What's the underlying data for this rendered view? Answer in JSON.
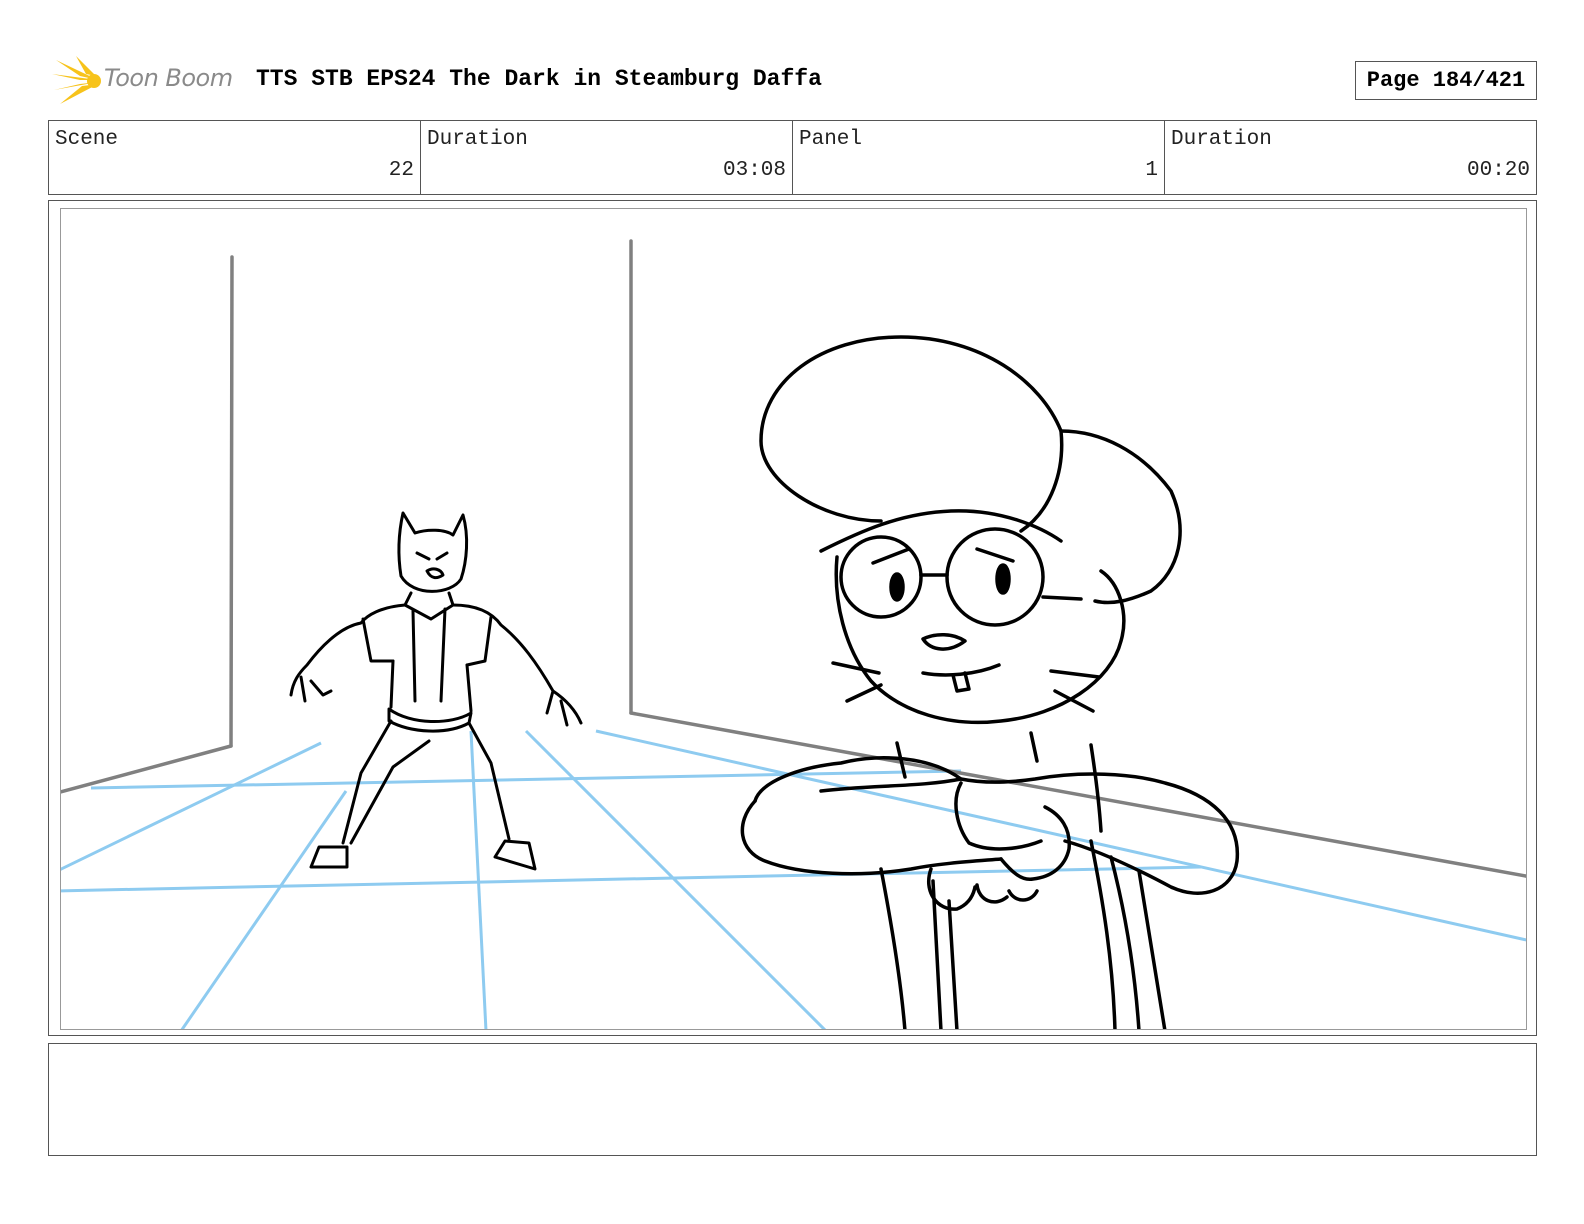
{
  "header": {
    "brand": "Toon Boom",
    "title": "TTS STB EPS24 The Dark in Steamburg Daffa",
    "page": "Page 184/421"
  },
  "info": [
    {
      "label": "Scene",
      "value": "22"
    },
    {
      "label": "Duration",
      "value": "03:08"
    },
    {
      "label": "Panel",
      "value": "1"
    },
    {
      "label": "Duration",
      "value": "00:20"
    }
  ],
  "notes": "",
  "colors": {
    "logo_yellow": "#f7c31b",
    "logo_gray": "#8a8a8a",
    "perspective_blue": "#8ecbf0",
    "wall_gray": "#808080",
    "ink": "#000000"
  }
}
